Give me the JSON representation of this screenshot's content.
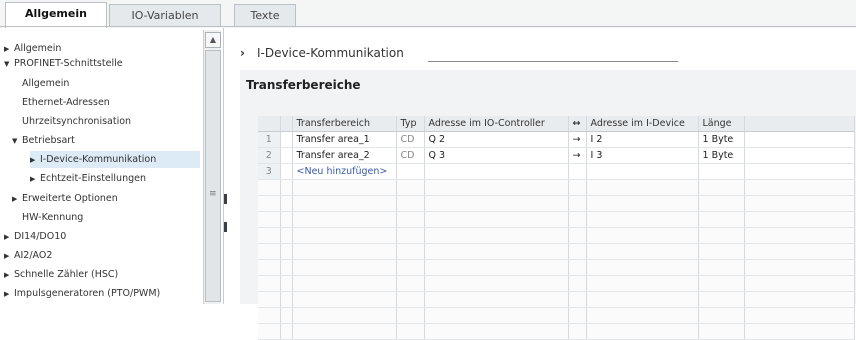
{
  "tabs": [
    {
      "label": "Allgemein",
      "active": true
    },
    {
      "label": "IO-Variablen",
      "active": false
    },
    {
      "label": "Texte",
      "active": false
    }
  ],
  "nav": {
    "items": [
      {
        "label": "Allgemein",
        "arrow": "▶"
      },
      {
        "label": "PROFINET-Schnittstelle",
        "arrow": "▼"
      },
      {
        "label": "Allgemein",
        "arrow": ""
      },
      {
        "label": "Ethernet-Adressen",
        "arrow": ""
      },
      {
        "label": "Uhrzeitsynchronisation",
        "arrow": ""
      },
      {
        "label": "Betriebsart",
        "arrow": "▼"
      },
      {
        "label": "I-Device-Kommunikation",
        "arrow": "▶",
        "selected": true
      },
      {
        "label": "Echtzeit-Einstellungen",
        "arrow": "▶"
      },
      {
        "label": "Erweiterte Optionen",
        "arrow": "▶"
      },
      {
        "label": "HW-Kennung",
        "arrow": ""
      },
      {
        "label": "DI14/DO10",
        "arrow": "▶"
      },
      {
        "label": "AI2/AO2",
        "arrow": "▶"
      },
      {
        "label": "Schnelle Zähler (HSC)",
        "arrow": "▶"
      },
      {
        "label": "Impulsgeneratoren (PTO/PWM)",
        "arrow": "▶"
      }
    ],
    "scroll_up": "▲",
    "scroll_mark": "≡"
  },
  "content": {
    "section_arrow": "›",
    "section_title": "I-Device-Kommunikation",
    "panel_title": "Transferbereiche"
  },
  "table": {
    "headers": {
      "name": "Transferbereich",
      "type": "Typ",
      "addr_ctrl": "Adresse im IO-Controller",
      "dir": "↔",
      "addr_dev": "Adresse im I-Device",
      "len": "Länge"
    },
    "rows": [
      {
        "num": "1",
        "name": "Transfer area_1",
        "type": "CD",
        "addr_ctrl": "Q 2",
        "dir": "→",
        "addr_dev": "I 2",
        "len": "1 Byte"
      },
      {
        "num": "2",
        "name": "Transfer area_2",
        "type": "CD",
        "addr_ctrl": "Q 3",
        "dir": "→",
        "addr_dev": "I 3",
        "len": "1 Byte"
      },
      {
        "num": "3",
        "name": "<Neu hinzufügen>",
        "type": "",
        "addr_ctrl": "",
        "dir": "",
        "addr_dev": "",
        "len": ""
      }
    ]
  }
}
